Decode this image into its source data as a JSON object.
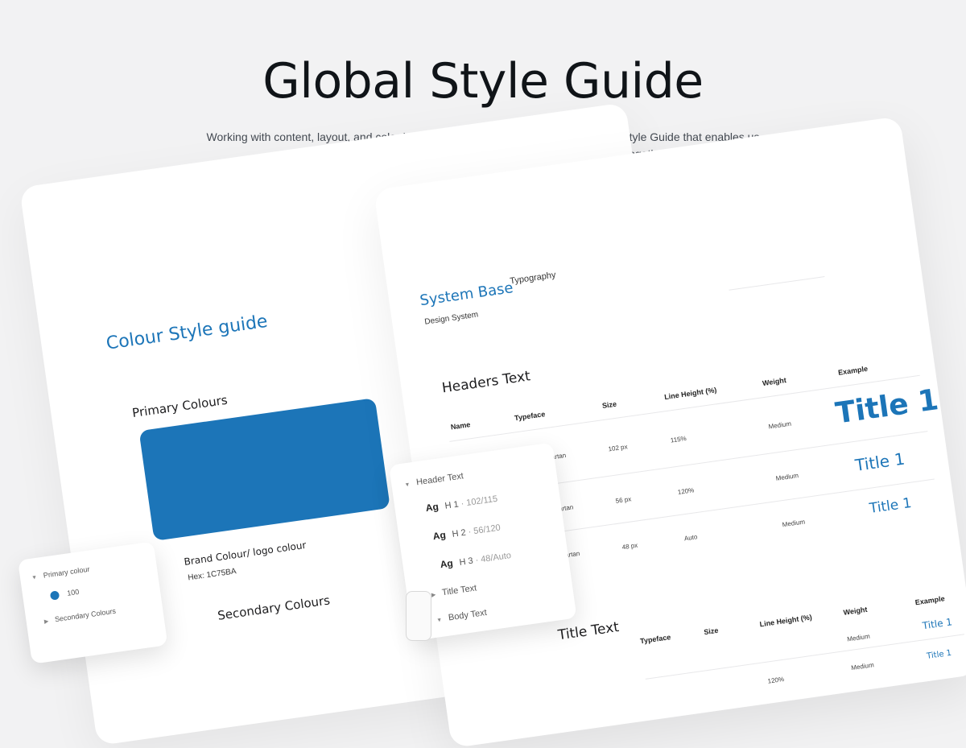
{
  "hero": {
    "title": "Global Style Guide",
    "subtitle": "Working with content, layout, and color has never been better, thanks to the Global Style Guide that enables us to collaborate seamlessly and create a cohesive visual experience together.\""
  },
  "colour_card": {
    "title": "Colour Style guide",
    "primary_heading": "Primary Colours",
    "brand_label": "Brand Colour/ logo colour",
    "hex_label": "Hex: 1C75BA",
    "secondary_heading": "Secondary Colours",
    "brand_color": "#1c75b8"
  },
  "typography_card": {
    "brand": "System Base",
    "tag": "Typography",
    "subtitle": "Design System",
    "headers_title": "Headers Text",
    "columns": [
      "Name",
      "Typeface",
      "Size",
      "Line Height (%)",
      "Weight",
      "Example"
    ],
    "rows": [
      {
        "typeface": "League Spartan",
        "size": "102 px",
        "line_height": "115%",
        "weight": "Medium",
        "example": "Title 1"
      },
      {
        "typeface": "League Spartan",
        "size": "56 px",
        "line_height": "120%",
        "weight": "Medium",
        "example": "Title 1"
      },
      {
        "typeface": "League Spartan",
        "size": "48 px",
        "line_height": "Auto",
        "weight": "Medium",
        "example": "Title 1"
      }
    ],
    "title_text_heading": "Title Text",
    "title_columns": [
      "Typeface",
      "Size",
      "Line Height (%)",
      "Weight",
      "Example"
    ],
    "title_rows": [
      {
        "line_height": "120%",
        "weight": "Medium",
        "example": "Title 1"
      },
      {
        "weight": "Medium",
        "example": "Title 1"
      }
    ]
  },
  "header_panel": {
    "group_label": "Header Text",
    "items": [
      {
        "ag": "Ag",
        "label": "H 1",
        "meta": "· 102/115"
      },
      {
        "ag": "Ag",
        "label": "H 2",
        "meta": "· 56/120"
      },
      {
        "ag": "Ag",
        "label": "H 3",
        "meta": "· 48/Auto"
      }
    ],
    "title_text": "Title Text",
    "body_text": "Body Text"
  },
  "colour_panel": {
    "primary": "Primary colour",
    "swatch_value": "100",
    "secondary": "Secondary Colours"
  }
}
